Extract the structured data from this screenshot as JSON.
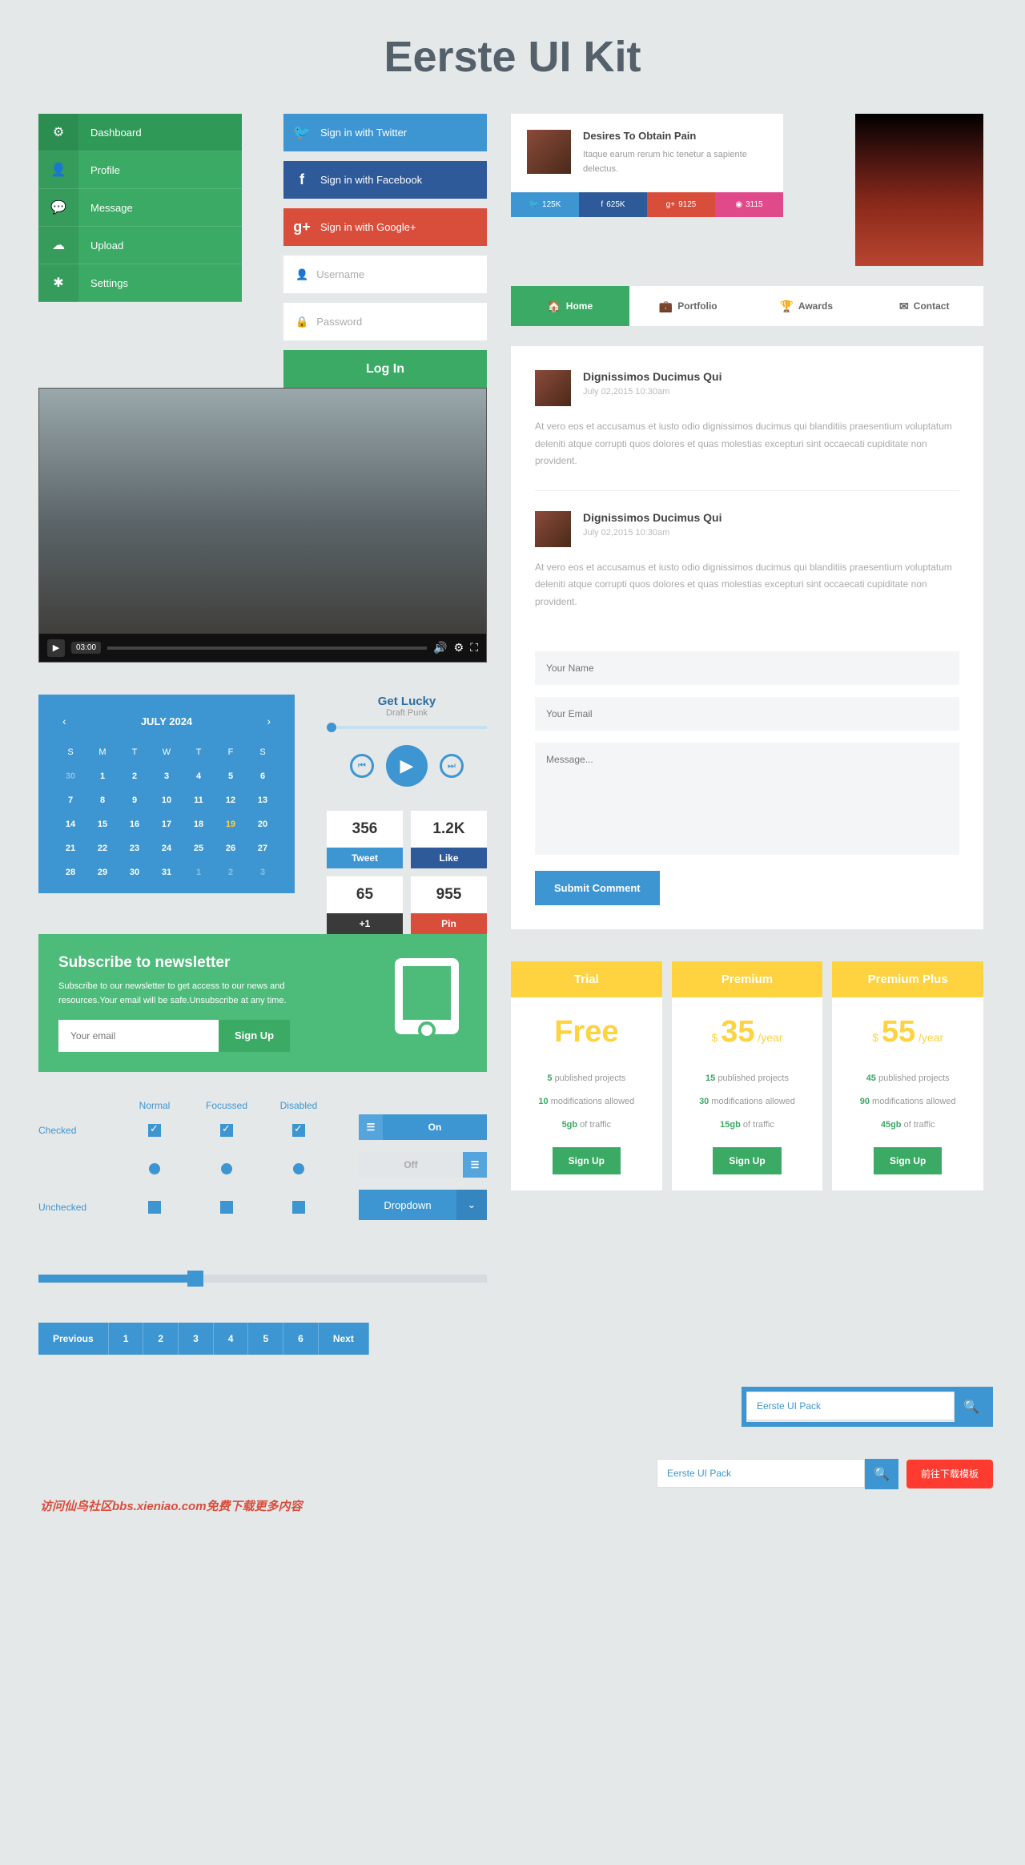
{
  "title": "Eerste UI Kit",
  "nav": [
    {
      "icon": "⚙",
      "label": "Dashboard"
    },
    {
      "icon": "👤",
      "label": "Profile"
    },
    {
      "icon": "💬",
      "label": "Message"
    },
    {
      "icon": "☁",
      "label": "Upload"
    },
    {
      "icon": "✱",
      "label": "Settings"
    }
  ],
  "signin": {
    "twitter": "Sign in with Twitter",
    "facebook": "Sign in with Facebook",
    "google": "Sign in with Google+",
    "username_ph": "Username",
    "password_ph": "Password",
    "login": "Log In"
  },
  "video": {
    "time": "03:00"
  },
  "calendar": {
    "month": "JULY 2024",
    "dow": [
      "S",
      "M",
      "T",
      "W",
      "T",
      "F",
      "S"
    ],
    "rows": [
      [
        {
          "d": "30",
          "dim": true
        },
        {
          "d": "1"
        },
        {
          "d": "2"
        },
        {
          "d": "3"
        },
        {
          "d": "4"
        },
        {
          "d": "5"
        },
        {
          "d": "6"
        }
      ],
      [
        {
          "d": "7"
        },
        {
          "d": "8"
        },
        {
          "d": "9"
        },
        {
          "d": "10"
        },
        {
          "d": "11"
        },
        {
          "d": "12"
        },
        {
          "d": "13"
        }
      ],
      [
        {
          "d": "14"
        },
        {
          "d": "15"
        },
        {
          "d": "16"
        },
        {
          "d": "17"
        },
        {
          "d": "18"
        },
        {
          "d": "19",
          "today": true
        },
        {
          "d": "20"
        }
      ],
      [
        {
          "d": "21"
        },
        {
          "d": "22"
        },
        {
          "d": "23"
        },
        {
          "d": "24"
        },
        {
          "d": "25"
        },
        {
          "d": "26"
        },
        {
          "d": "27"
        }
      ],
      [
        {
          "d": "28"
        },
        {
          "d": "29"
        },
        {
          "d": "30"
        },
        {
          "d": "31"
        },
        {
          "d": "1",
          "dim": true
        },
        {
          "d": "2",
          "dim": true
        },
        {
          "d": "3",
          "dim": true
        }
      ]
    ]
  },
  "player": {
    "track": "Get Lucky",
    "artist": "Draft Punk"
  },
  "stats": [
    {
      "num": "356",
      "act": "Tweet",
      "cls": "tw"
    },
    {
      "num": "1.2K",
      "act": "Like",
      "cls": "fb"
    },
    {
      "num": "65",
      "act": "+1",
      "cls": "gp"
    },
    {
      "num": "955",
      "act": "Pin",
      "cls": "pin"
    }
  ],
  "newsletter": {
    "title": "Subscribe to newsletter",
    "desc": "Subscribe to our newsletter to get access to our news and resources.Your email will be safe.Unsubscribe at any time.",
    "placeholder": "Your email",
    "signup": "Sign Up"
  },
  "checks": {
    "headers": [
      "Normal",
      "Focussed",
      "Disabled"
    ],
    "checked": "Checked",
    "unchecked": "Unchecked"
  },
  "toggles": {
    "on": "On",
    "off": "Off"
  },
  "dropdown": "Dropdown",
  "pagination": [
    "Previous",
    "1",
    "2",
    "3",
    "4",
    "5",
    "6",
    "Next"
  ],
  "card": {
    "title": "Desires To Obtain Pain",
    "text": "Itaque earum rerum hic tenetur a sapiente delectus."
  },
  "social_stats": [
    {
      "v": "125K"
    },
    {
      "v": "625K"
    },
    {
      "v": "9125"
    },
    {
      "v": "3115"
    }
  ],
  "tabs": [
    {
      "icon": "🏠",
      "label": "Home",
      "active": true
    },
    {
      "icon": "💼",
      "label": "Portfolio"
    },
    {
      "icon": "🏆",
      "label": "Awards"
    },
    {
      "icon": "✉",
      "label": "Contact"
    }
  ],
  "posts": [
    {
      "title": "Dignissimos Ducimus Qui",
      "date": "July 02,2015 10:30am",
      "body": "At vero eos et accusamus et iusto odio dignissimos ducimus qui blanditiis praesentium voluptatum deleniti atque corrupti quos dolores et quas molestias excepturi sint occaecati cupiditate non provident."
    },
    {
      "title": "Dignissimos Ducimus Qui",
      "date": "July 02,2015 10:30am",
      "body": "At vero eos et accusamus et iusto odio dignissimos ducimus qui blanditiis praesentium voluptatum deleniti atque corrupti quos dolores et quas molestias excepturi sint occaecati cupiditate non provident."
    }
  ],
  "comment": {
    "name_ph": "Your Name",
    "email_ph": "Your Email",
    "msg_ph": "Message...",
    "submit": "Submit Comment"
  },
  "pricing": [
    {
      "name": "Trial",
      "price": "Free",
      "period": "",
      "f1": "5",
      "f1t": " published projects",
      "f2": "10",
      "f2t": " modifications allowed",
      "f3": "5gb",
      "f3t": " of traffic"
    },
    {
      "name": "Premium",
      "price": "35",
      "period": "/year",
      "f1": "15",
      "f1t": " published projects",
      "f2": "30",
      "f2t": " modifications allowed",
      "f3": "15gb",
      "f3t": " of traffic"
    },
    {
      "name": "Premium Plus",
      "price": "55",
      "period": "/year",
      "f1": "45",
      "f1t": " published projects",
      "f2": "90",
      "f2t": " modifications allowed",
      "f3": "45gb",
      "f3t": " of traffic"
    }
  ],
  "plan_signup": "Sign Up",
  "search": {
    "value": "Eerste UI Pack"
  },
  "download": "前往下载模板",
  "watermark": "访问仙鸟社区bbs.xieniao.com免费下载更多内容"
}
